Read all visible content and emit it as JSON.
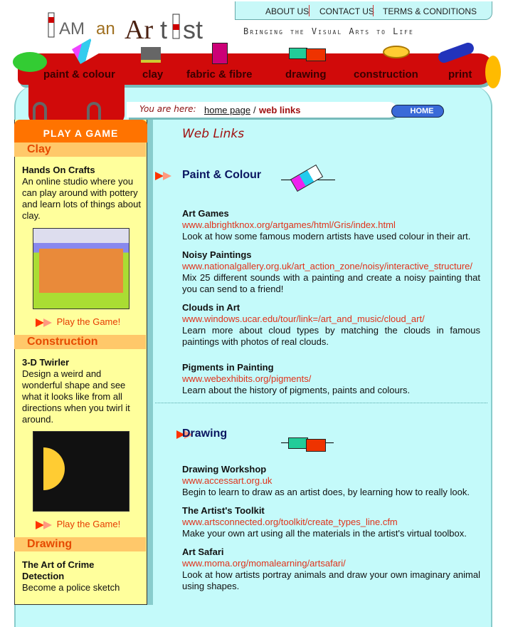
{
  "header": {
    "logo": "I AM an Artist",
    "tagline": "Bringing the Visual Arts to Life",
    "top_links": [
      "ABOUT US",
      "CONTACT US",
      "TERMS & CONDITIONS"
    ]
  },
  "nav": [
    "paint & colour",
    "clay",
    "fabric & fibre",
    "drawing",
    "construction",
    "print"
  ],
  "breadcrumb": {
    "prefix": "You are here:",
    "home": "home page",
    "sep": "/",
    "current": "web links",
    "home_button": "HOME"
  },
  "sidebar": {
    "title": "PLAY A GAME",
    "play_label": "Play the Game!",
    "sections": [
      {
        "header": "Clay",
        "title": "Hands On Crafts",
        "desc": "An online studio where you can play around with pottery and learn lots of things about clay."
      },
      {
        "header": "Construction",
        "title": "3-D Twirler",
        "desc": "Design a weird and wonderful shape and see what it looks like from all directions when you twirl it around."
      },
      {
        "header": "Drawing",
        "title": "The Art of Crime Detection",
        "desc": "Become a police sketch"
      }
    ]
  },
  "main": {
    "title": "Web Links",
    "sections": [
      {
        "heading": "Paint & Colour",
        "items": [
          {
            "title": "Art Games",
            "url": "www.albrightknox.org/artgames/html/Gris/index.html",
            "desc": "Look at how some famous modern artists have used colour in their art."
          },
          {
            "title": "Noisy Paintings",
            "url": "www.nationalgallery.org.uk/art_action_zone/noisy/interactive_structure/",
            "desc": "Mix 25 different sounds with a painting and create a noisy painting that you can send to a friend!"
          },
          {
            "title": "Clouds in Art",
            "url": "www.windows.ucar.edu/tour/link=/art_and_music/cloud_art/",
            "desc": "Learn more about cloud types by matching the clouds in famous paintings with photos of real clouds."
          },
          {
            "title": "Pigments in Painting",
            "url": "www.webexhibits.org/pigments/",
            "desc": "Learn about the history of pigments, paints and colours."
          }
        ]
      },
      {
        "heading": "Drawing",
        "items": [
          {
            "title": "Drawing Workshop",
            "url": "www.accessart.org.uk",
            "desc": "Begin to learn to draw as an artist does, by learning how to really look."
          },
          {
            "title": "The Artist's Toolkit",
            "url": "www.artsconnected.org/toolkit/create_types_line.cfm",
            "desc": "Make your own art using all the materials in the artist's virtual toolbox."
          },
          {
            "title": "Art Safari",
            "url": "www.moma.org/momalearning/artsafari/",
            "desc": "Look at how artists portray animals and draw your own imaginary animal using shapes."
          }
        ]
      }
    ]
  },
  "colors": {
    "nav_red": "#d10a0a",
    "link": "#e0321a",
    "heading": "#0a1560",
    "content_bg": "#c4fafa",
    "sidebar_bg": "#ffff9c",
    "sidebar_header": "#ff7300"
  }
}
